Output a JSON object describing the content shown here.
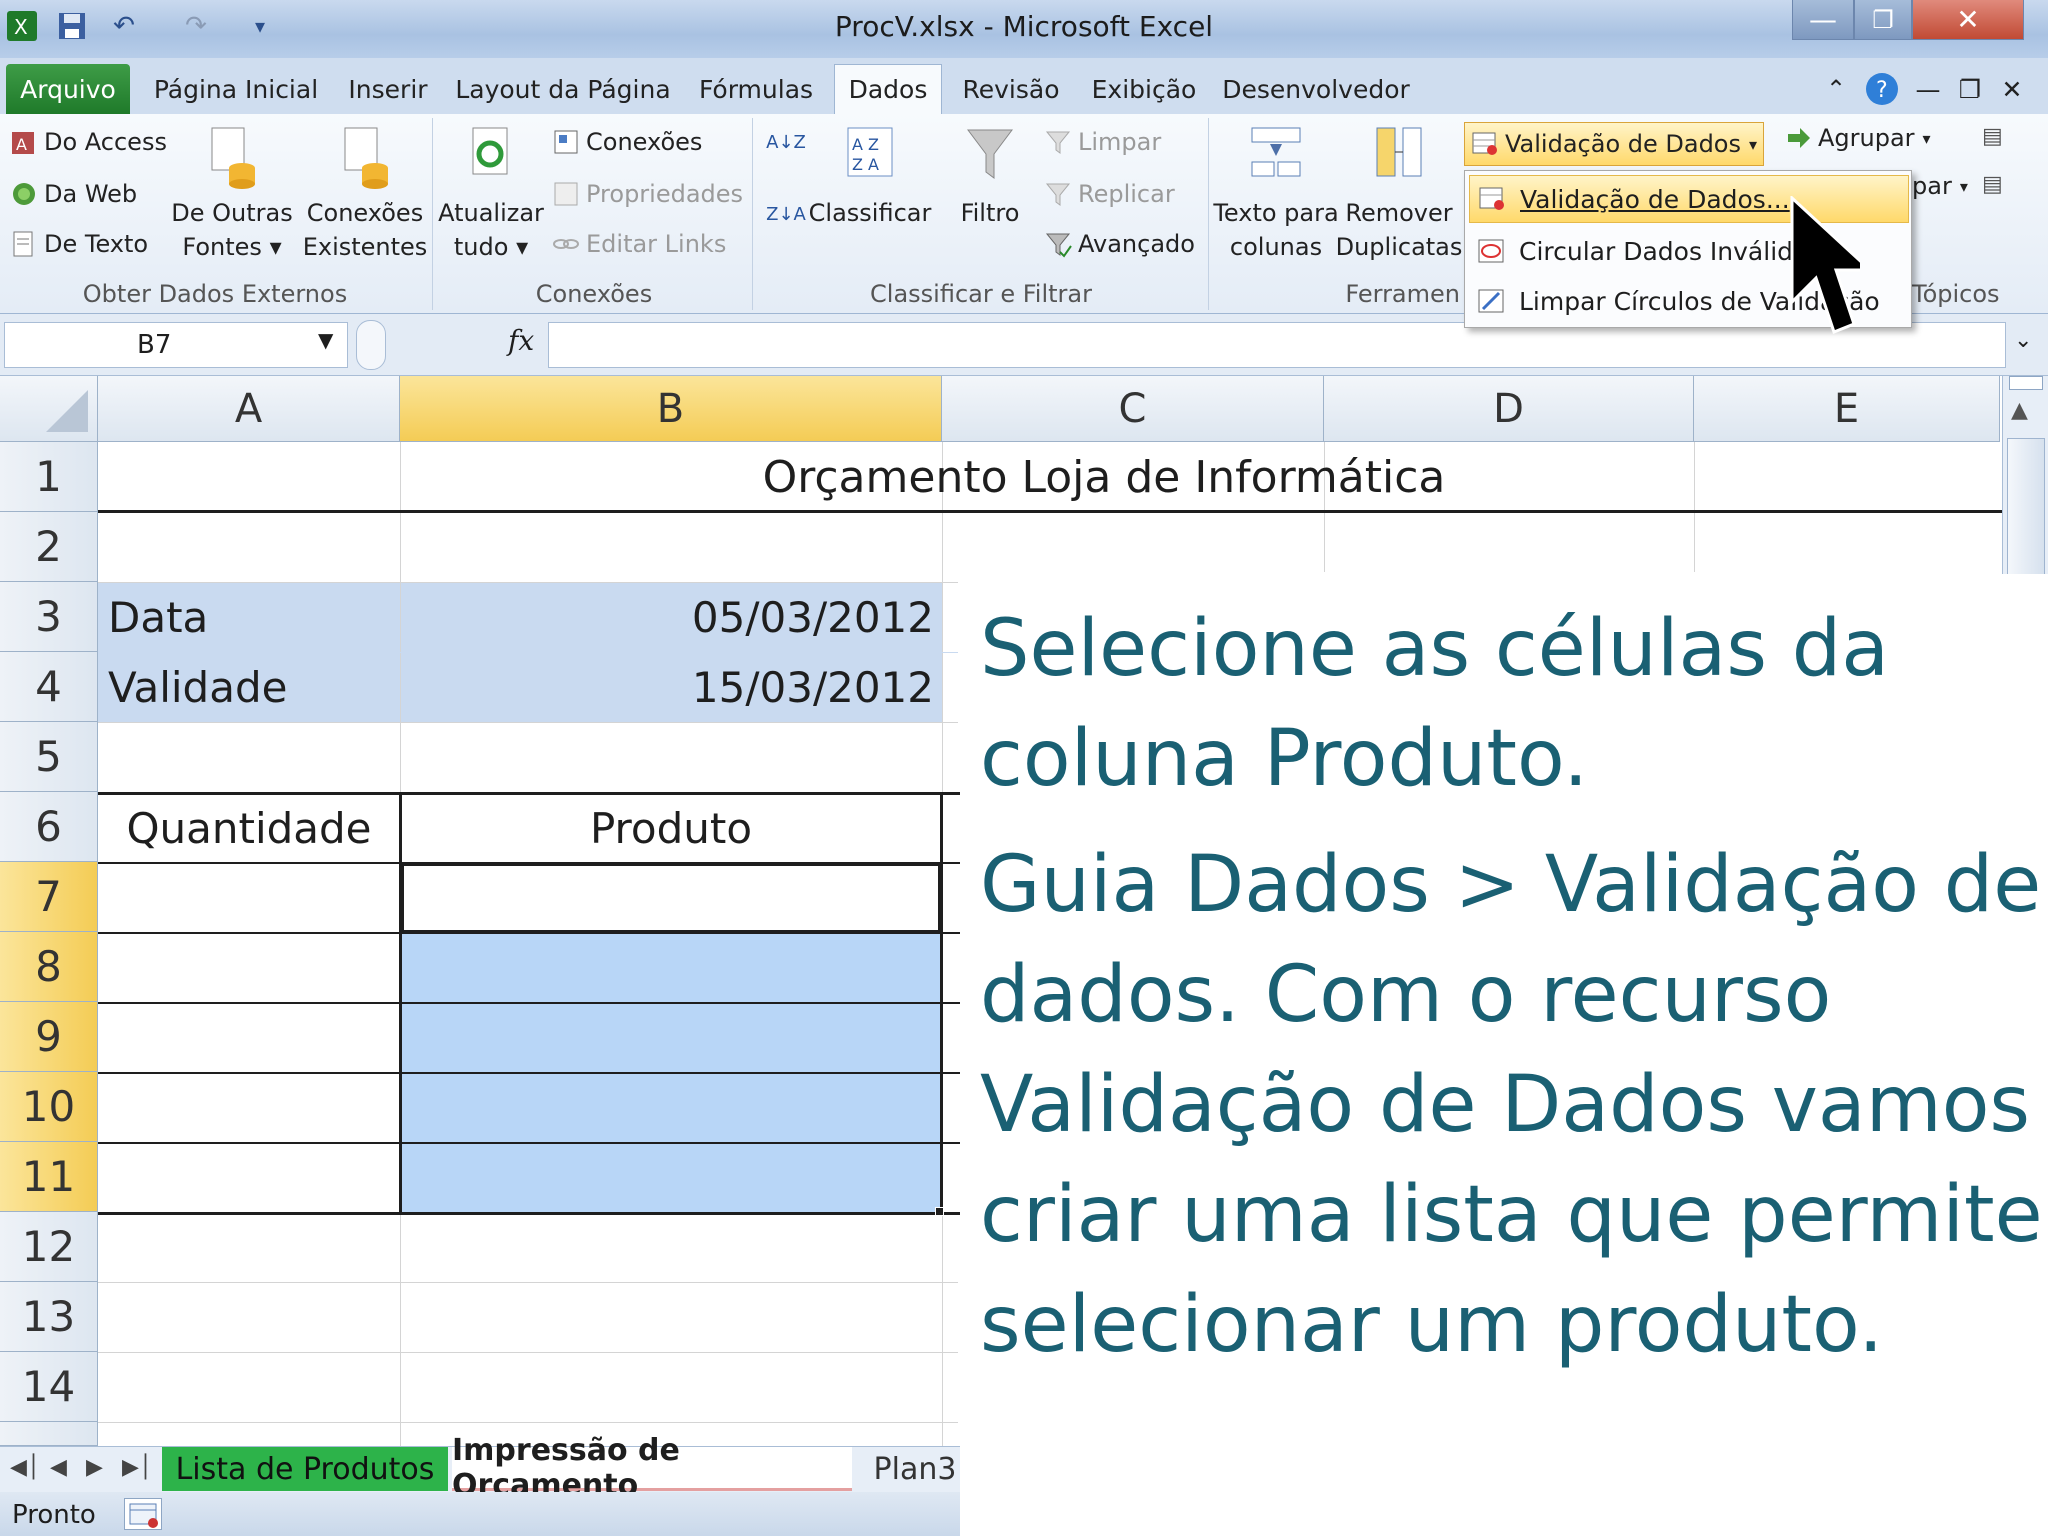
{
  "window": {
    "title": "ProcV.xlsx  -  Microsoft Excel",
    "controls": {
      "minimize": "—",
      "restore": "❐",
      "close": "✕"
    }
  },
  "ribbon_tabs": [
    "Arquivo",
    "Página Inicial",
    "Inserir",
    "Layout da Página",
    "Fórmulas",
    "Dados",
    "Revisão",
    "Exibição",
    "Desenvolvedor"
  ],
  "ribbon": {
    "external": {
      "access": "Do Access",
      "web": "Da Web",
      "text": "De Texto",
      "other_line1": "De Outras",
      "other_line2": "Fontes",
      "existing_line1": "Conexões",
      "existing_line2": "Existentes",
      "group": "Obter Dados Externos"
    },
    "connections": {
      "refresh_line1": "Atualizar",
      "refresh_line2": "tudo",
      "conexoes": "Conexões",
      "propriedades": "Propriedades",
      "editar_links": "Editar Links",
      "group": "Conexões"
    },
    "sort": {
      "az": "A↓Z",
      "za": "Z↓A",
      "classificar": "Classificar",
      "filtro": "Filtro",
      "limpar": "Limpar",
      "replicar": "Replicar",
      "avancado": "Avançado",
      "group": "Classificar e Filtrar"
    },
    "tools": {
      "texto_line1": "Texto para",
      "texto_line2": "colunas",
      "remover_line1": "Remover",
      "remover_line2": "Duplicatas",
      "validacao": "Validação de Dados",
      "group": "Ferramen"
    },
    "outline": {
      "agrupar": "Agrupar",
      "desagrupar": "par",
      "group": "Tópicos"
    }
  },
  "validation_menu": {
    "items": [
      "Validação de Dados...",
      "Circular Dados Inválidos",
      "Limpar Círculos de Validação"
    ]
  },
  "formula_bar": {
    "name_box": "B7",
    "fx": "fx",
    "formula": ""
  },
  "columns": [
    "A",
    "B",
    "C",
    "D",
    "E"
  ],
  "rows": [
    "1",
    "2",
    "3",
    "4",
    "5",
    "6",
    "7",
    "8",
    "9",
    "10",
    "11",
    "12",
    "13",
    "14"
  ],
  "sheet": {
    "title": "Orçamento Loja de Informática",
    "data_label": "Data",
    "data_value": "05/03/2012",
    "validade_label": "Validade",
    "validade_value": "15/03/2012",
    "col_quantidade": "Quantidade",
    "col_produto": "Produto"
  },
  "sheet_tabs": [
    "Lista de Produtos",
    "Impressão de Orçamento",
    "Plan3"
  ],
  "status": {
    "text": "Pronto"
  },
  "instructions": [
    "Selecione as células da",
    "coluna Produto.",
    "Guia Dados > Validação de",
    "dados. Com o recurso",
    "Validação de Dados vamos",
    "criar uma lista que permite",
    "selecionar um produto."
  ],
  "colors": {
    "accent_selection": "#b8d6f7",
    "info_block": "#c9daf0",
    "header_selected": "#f4cc55",
    "instruction_text": "#1a6073",
    "file_tab": "#1f7a2a",
    "sheet_tab_green": "#2db34a"
  }
}
